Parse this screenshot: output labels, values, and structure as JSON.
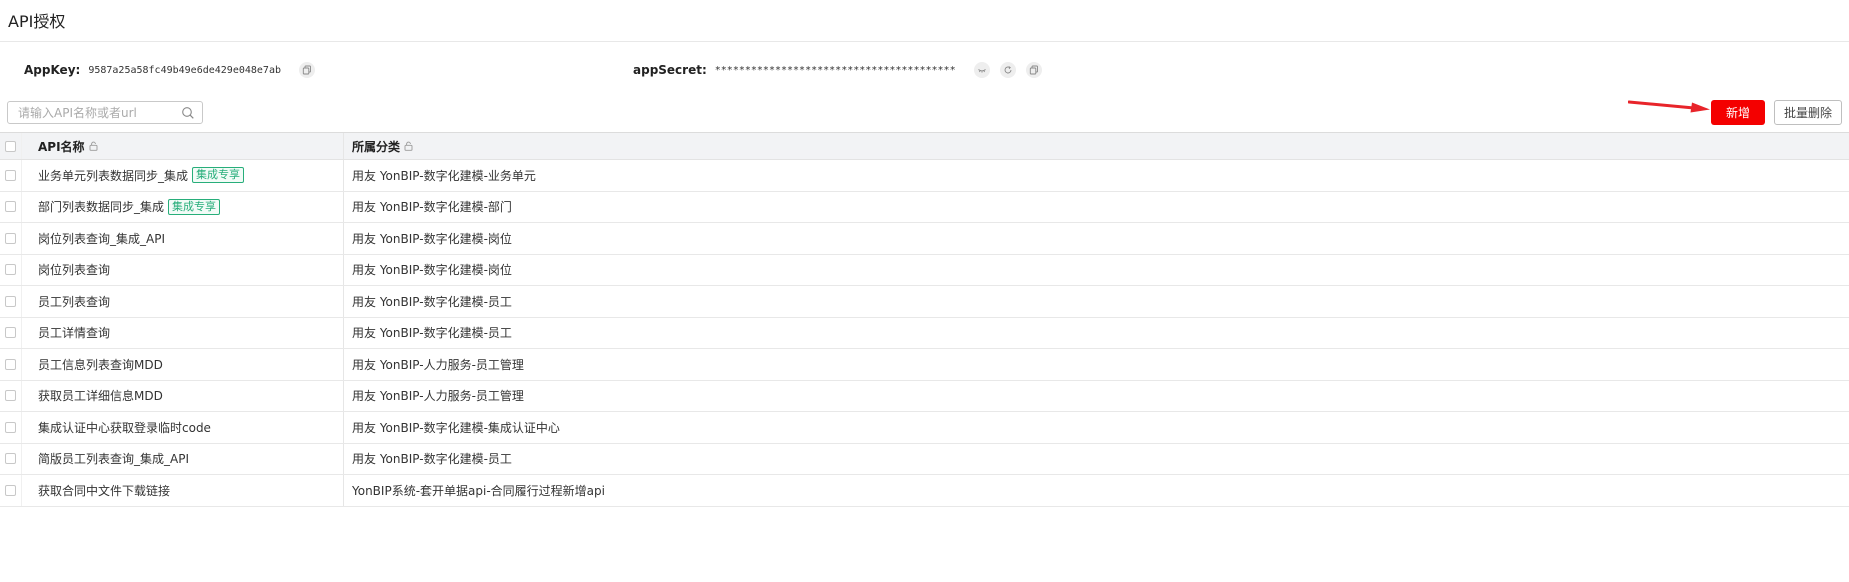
{
  "page": {
    "title": "API授权"
  },
  "credentials": {
    "appkey_label": "AppKey:",
    "appkey_value": "9587a25a58fc49b49e6de429e048e7ab",
    "appsecret_label": "appSecret:",
    "appsecret_value": "****************************************"
  },
  "search": {
    "placeholder": "请输入API名称或者url"
  },
  "toolbar": {
    "add_label": "新增",
    "batch_delete_label": "批量删除"
  },
  "table": {
    "columns": [
      "API名称",
      "所属分类"
    ],
    "rows": [
      {
        "name": "业务单元列表数据同步_集成",
        "tag": "集成专享",
        "category": "用友 YonBIP-数字化建模-业务单元"
      },
      {
        "name": "部门列表数据同步_集成",
        "tag": "集成专享",
        "category": "用友 YonBIP-数字化建模-部门"
      },
      {
        "name": "岗位列表查询_集成_API",
        "tag": "",
        "category": "用友 YonBIP-数字化建模-岗位"
      },
      {
        "name": "岗位列表查询",
        "tag": "",
        "category": "用友 YonBIP-数字化建模-岗位"
      },
      {
        "name": "员工列表查询",
        "tag": "",
        "category": "用友 YonBIP-数字化建模-员工"
      },
      {
        "name": "员工详情查询",
        "tag": "",
        "category": "用友 YonBIP-数字化建模-员工"
      },
      {
        "name": "员工信息列表查询MDD",
        "tag": "",
        "category": "用友 YonBIP-人力服务-员工管理"
      },
      {
        "name": "获取员工详细信息MDD",
        "tag": "",
        "category": "用友 YonBIP-人力服务-员工管理"
      },
      {
        "name": "集成认证中心获取登录临时code",
        "tag": "",
        "category": "用友 YonBIP-数字化建模-集成认证中心"
      },
      {
        "name": "简版员工列表查询_集成_API",
        "tag": "",
        "category": "用友 YonBIP-数字化建模-员工"
      },
      {
        "name": "获取合同中文件下载链接",
        "tag": "",
        "category": "YonBIP系统-套开单据api-合同履行过程新增api"
      }
    ]
  },
  "colors": {
    "add_button": "#f40000",
    "annotation_arrow": "#e8242a",
    "tag": "#27ae7a"
  }
}
